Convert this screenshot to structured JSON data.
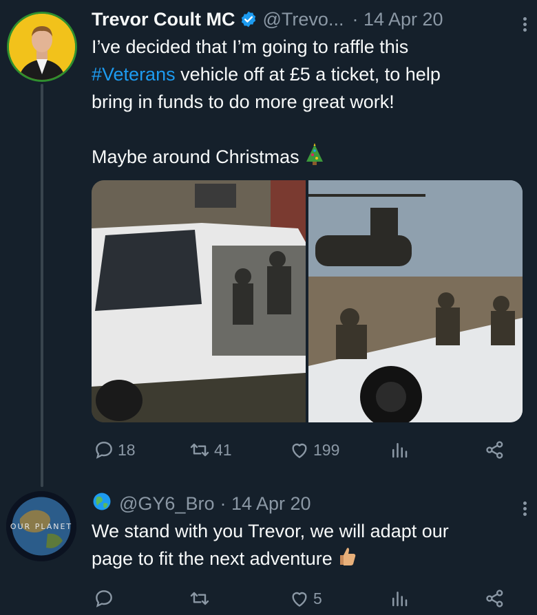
{
  "tweet1": {
    "name": "Trevor Coult MC",
    "handle": "@Trevo...",
    "date": "· 14 Apr 20",
    "text_part1": "I’ve decided that I’m going to raffle this",
    "hashtag": "#Veterans",
    "text_part2": " vehicle off at £5 a ticket, to help",
    "text_part3": "bring in funds to do more great work!",
    "text_part4": "Maybe around Christmas",
    "reply_count": "18",
    "retweet_count": "41",
    "like_count": "199"
  },
  "tweet2": {
    "avatar_text": "OUR PLANET",
    "handle": "@GY6_Bro",
    "date": "· 14 Apr 20",
    "text_line1": "We stand with you Trevor, we will adapt our",
    "text_line2": "page to fit the next adventure",
    "reply_count": "",
    "retweet_count": "",
    "like_count": "5"
  },
  "colors": {
    "background": "#15202b",
    "text": "#f7f9f9",
    "muted": "#8b98a5",
    "accent": "#1d9bf0"
  }
}
